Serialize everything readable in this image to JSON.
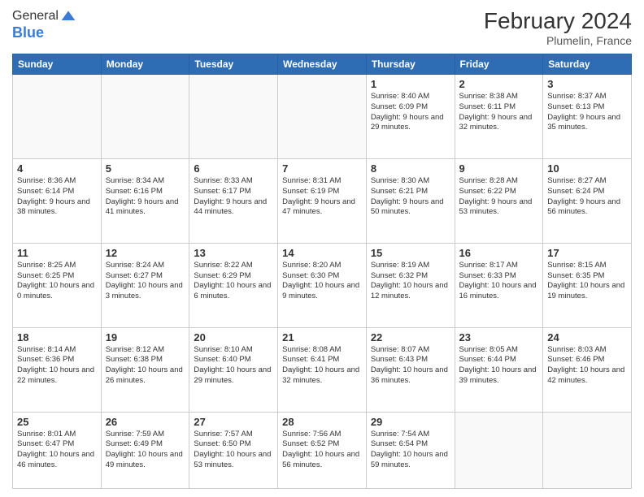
{
  "header": {
    "logo_general": "General",
    "logo_blue": "Blue",
    "month_title": "February 2024",
    "location": "Plumelin, France"
  },
  "days_of_week": [
    "Sunday",
    "Monday",
    "Tuesday",
    "Wednesday",
    "Thursday",
    "Friday",
    "Saturday"
  ],
  "weeks": [
    [
      {
        "num": "",
        "info": ""
      },
      {
        "num": "",
        "info": ""
      },
      {
        "num": "",
        "info": ""
      },
      {
        "num": "",
        "info": ""
      },
      {
        "num": "1",
        "info": "Sunrise: 8:40 AM\nSunset: 6:09 PM\nDaylight: 9 hours and 29 minutes."
      },
      {
        "num": "2",
        "info": "Sunrise: 8:38 AM\nSunset: 6:11 PM\nDaylight: 9 hours and 32 minutes."
      },
      {
        "num": "3",
        "info": "Sunrise: 8:37 AM\nSunset: 6:13 PM\nDaylight: 9 hours and 35 minutes."
      }
    ],
    [
      {
        "num": "4",
        "info": "Sunrise: 8:36 AM\nSunset: 6:14 PM\nDaylight: 9 hours and 38 minutes."
      },
      {
        "num": "5",
        "info": "Sunrise: 8:34 AM\nSunset: 6:16 PM\nDaylight: 9 hours and 41 minutes."
      },
      {
        "num": "6",
        "info": "Sunrise: 8:33 AM\nSunset: 6:17 PM\nDaylight: 9 hours and 44 minutes."
      },
      {
        "num": "7",
        "info": "Sunrise: 8:31 AM\nSunset: 6:19 PM\nDaylight: 9 hours and 47 minutes."
      },
      {
        "num": "8",
        "info": "Sunrise: 8:30 AM\nSunset: 6:21 PM\nDaylight: 9 hours and 50 minutes."
      },
      {
        "num": "9",
        "info": "Sunrise: 8:28 AM\nSunset: 6:22 PM\nDaylight: 9 hours and 53 minutes."
      },
      {
        "num": "10",
        "info": "Sunrise: 8:27 AM\nSunset: 6:24 PM\nDaylight: 9 hours and 56 minutes."
      }
    ],
    [
      {
        "num": "11",
        "info": "Sunrise: 8:25 AM\nSunset: 6:25 PM\nDaylight: 10 hours and 0 minutes."
      },
      {
        "num": "12",
        "info": "Sunrise: 8:24 AM\nSunset: 6:27 PM\nDaylight: 10 hours and 3 minutes."
      },
      {
        "num": "13",
        "info": "Sunrise: 8:22 AM\nSunset: 6:29 PM\nDaylight: 10 hours and 6 minutes."
      },
      {
        "num": "14",
        "info": "Sunrise: 8:20 AM\nSunset: 6:30 PM\nDaylight: 10 hours and 9 minutes."
      },
      {
        "num": "15",
        "info": "Sunrise: 8:19 AM\nSunset: 6:32 PM\nDaylight: 10 hours and 12 minutes."
      },
      {
        "num": "16",
        "info": "Sunrise: 8:17 AM\nSunset: 6:33 PM\nDaylight: 10 hours and 16 minutes."
      },
      {
        "num": "17",
        "info": "Sunrise: 8:15 AM\nSunset: 6:35 PM\nDaylight: 10 hours and 19 minutes."
      }
    ],
    [
      {
        "num": "18",
        "info": "Sunrise: 8:14 AM\nSunset: 6:36 PM\nDaylight: 10 hours and 22 minutes."
      },
      {
        "num": "19",
        "info": "Sunrise: 8:12 AM\nSunset: 6:38 PM\nDaylight: 10 hours and 26 minutes."
      },
      {
        "num": "20",
        "info": "Sunrise: 8:10 AM\nSunset: 6:40 PM\nDaylight: 10 hours and 29 minutes."
      },
      {
        "num": "21",
        "info": "Sunrise: 8:08 AM\nSunset: 6:41 PM\nDaylight: 10 hours and 32 minutes."
      },
      {
        "num": "22",
        "info": "Sunrise: 8:07 AM\nSunset: 6:43 PM\nDaylight: 10 hours and 36 minutes."
      },
      {
        "num": "23",
        "info": "Sunrise: 8:05 AM\nSunset: 6:44 PM\nDaylight: 10 hours and 39 minutes."
      },
      {
        "num": "24",
        "info": "Sunrise: 8:03 AM\nSunset: 6:46 PM\nDaylight: 10 hours and 42 minutes."
      }
    ],
    [
      {
        "num": "25",
        "info": "Sunrise: 8:01 AM\nSunset: 6:47 PM\nDaylight: 10 hours and 46 minutes."
      },
      {
        "num": "26",
        "info": "Sunrise: 7:59 AM\nSunset: 6:49 PM\nDaylight: 10 hours and 49 minutes."
      },
      {
        "num": "27",
        "info": "Sunrise: 7:57 AM\nSunset: 6:50 PM\nDaylight: 10 hours and 53 minutes."
      },
      {
        "num": "28",
        "info": "Sunrise: 7:56 AM\nSunset: 6:52 PM\nDaylight: 10 hours and 56 minutes."
      },
      {
        "num": "29",
        "info": "Sunrise: 7:54 AM\nSunset: 6:54 PM\nDaylight: 10 hours and 59 minutes."
      },
      {
        "num": "",
        "info": ""
      },
      {
        "num": "",
        "info": ""
      }
    ]
  ]
}
